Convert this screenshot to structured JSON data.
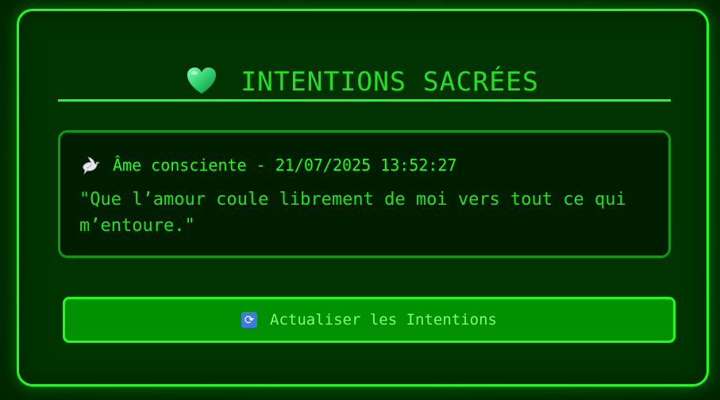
{
  "header": {
    "icon": "green-heart-icon",
    "title": "INTENTIONS SACRÉES"
  },
  "entries": [
    {
      "icon": "dove-icon",
      "meta": "Âme consciente - 21/07/2025 13:52:27",
      "text": "\"Que l’amour coule librement de moi vers tout ce qui m’entoure.\""
    }
  ],
  "refresh_button": {
    "icon": "refresh-icon",
    "label": "Actualiser les Intentions"
  },
  "colors": {
    "accent": "#1aff1a",
    "panel_bg": "#003300",
    "entry_bg": "#001d00",
    "button_bg": "#009000",
    "text": "#22e022"
  }
}
